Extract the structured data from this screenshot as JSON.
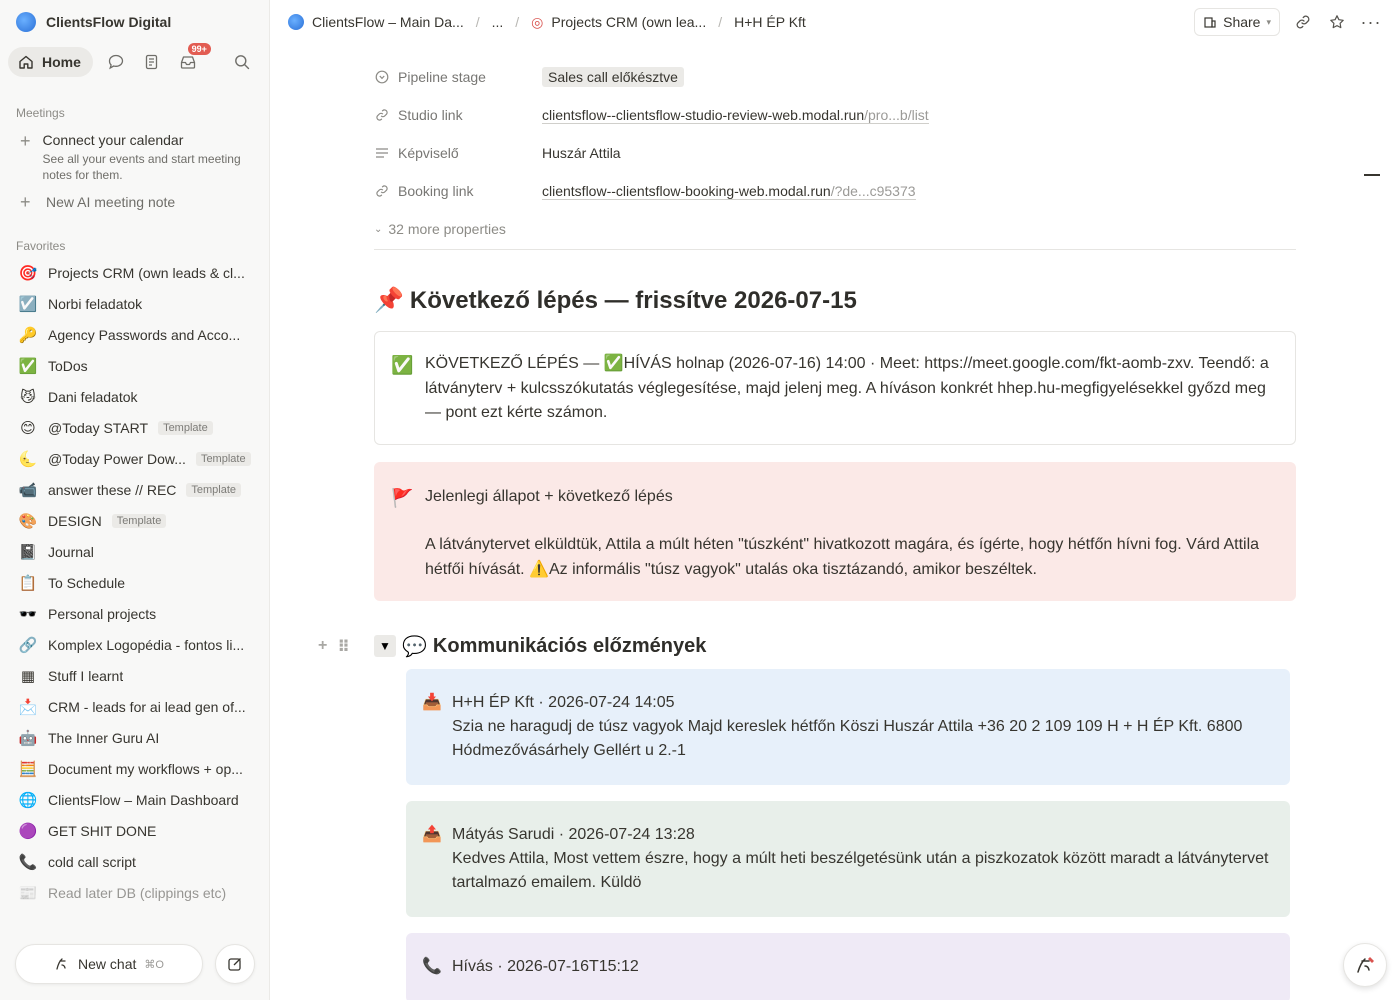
{
  "sidebar": {
    "workspace": "ClientsFlow Digital",
    "home": "Home",
    "inbox_badge": "99+",
    "meetings_label": "Meetings",
    "connect_title": "Connect your calendar",
    "connect_sub": "See all your events and start meeting notes for them.",
    "new_ai_note": "New AI meeting note",
    "favorites_label": "Favorites",
    "favorites": [
      {
        "icon": "🎯",
        "label": "Projects CRM (own leads & cl...",
        "template": ""
      },
      {
        "icon": "☑️",
        "label": "Norbi feladatok",
        "template": ""
      },
      {
        "icon": "🔑",
        "label": "Agency Passwords and Acco...",
        "template": ""
      },
      {
        "icon": "✅",
        "label": "ToDos",
        "template": ""
      },
      {
        "icon": "😼",
        "label": "Dani feladatok",
        "template": ""
      },
      {
        "icon": "😊",
        "label": "@Today START",
        "template": "Template"
      },
      {
        "icon": "🌜",
        "label": "@Today Power Dow...",
        "template": "Template"
      },
      {
        "icon": "📹",
        "label": "answer these // REC",
        "template": "Template"
      },
      {
        "icon": "🎨",
        "label": "DESIGN",
        "template": "Template"
      },
      {
        "icon": "📓",
        "label": "Journal",
        "template": ""
      },
      {
        "icon": "📋",
        "label": "To Schedule",
        "template": ""
      },
      {
        "icon": "🕶️",
        "label": "Personal projects",
        "template": ""
      },
      {
        "icon": "🔗",
        "label": "Komplex Logopédia - fontos li...",
        "template": ""
      },
      {
        "icon": "▦",
        "label": "Stuff I learnt",
        "template": ""
      },
      {
        "icon": "📩",
        "label": "CRM - leads for ai lead gen of...",
        "template": ""
      },
      {
        "icon": "🤖",
        "label": "The Inner Guru AI",
        "template": ""
      },
      {
        "icon": "🧮",
        "label": "Document my workflows + op...",
        "template": ""
      },
      {
        "icon": "🌐",
        "label": "ClientsFlow – Main Dashboard",
        "template": ""
      },
      {
        "icon": "🟣",
        "label": "GET SHIT DONE",
        "template": ""
      },
      {
        "icon": "📞",
        "label": "cold call script",
        "template": ""
      },
      {
        "icon": "📰",
        "label": "Read later DB (clippings etc)",
        "template": ""
      }
    ],
    "new_chat": "New chat",
    "new_chat_kbd": "⌘O"
  },
  "topbar": {
    "crumb1": "ClientsFlow – Main Da...",
    "crumb2": "...",
    "crumb3": "Projects CRM (own lea...",
    "crumb4": "H+H ÉP Kft",
    "share": "Share"
  },
  "properties": {
    "pipeline_label": "Pipeline stage",
    "pipeline_value": "Sales call előkésztve",
    "studio_label": "Studio link",
    "studio_main": "clientsflow--clientsflow-studio-review-web.modal.run",
    "studio_dim": "/pro...b/list",
    "rep_label": "Képviselő",
    "rep_value": "Huszár Attila",
    "booking_label": "Booking link",
    "booking_main": "clientsflow--clientsflow-booking-web.modal.run",
    "booking_dim": "/?de...c95373",
    "more": "32 more properties"
  },
  "next_step": {
    "heading_icon": "📌",
    "heading": "Következő lépés — frissítve 2026-07-15",
    "callout_icon": "✅",
    "callout_text": "KÖVETKEZŐ LÉPÉS — ✅HÍVÁS holnap (2026-07-16) 14:00 · Meet: https://meet.google.com/fkt-aomb-zxv. Teendő: a látványterv + kulcsszókutatás véglegesítése, majd jelenj meg. A híváson konkrét hhep.hu-megfigyelésekkel győzd meg — pont ezt kérte számon."
  },
  "status_callout": {
    "icon": "🚩",
    "title": "Jelenlegi állapot + következő lépés",
    "body": "A látványtervet elküldtük, Attila a múlt héten \"túszként\" hivatkozott magára, és ígérte, hogy hétfőn hívni fog. Várd Attila hétfői hívását. ⚠️Az informális \"túsz vagyok\" utalás oka tisztázandó, amikor beszéltek."
  },
  "history": {
    "icon": "💬",
    "heading": "Kommunikációs előzmények",
    "messages": [
      {
        "icon": "📥",
        "title": "H+H ÉP Kft · 2026-07-24 14:05",
        "body": "Szia ne haragudj de túsz vagyok Majd kereslek hétfőn Köszi Huszár Attila +36 20 2 109 109 H + H ÉP Kft. 6800 Hódmezővásárhely Gellért u 2.-1"
      },
      {
        "icon": "📤",
        "title": "Mátyás Sarudi · 2026-07-24 13:28",
        "body": "Kedves Attila, Most vettem észre, hogy a múlt heti beszélgetésünk után a piszkozatok között maradt a látványtervet tartalmazó emailem. Küldö"
      },
      {
        "icon": "📞",
        "title": "Hívás · 2026-07-16T15:12",
        "body": ""
      }
    ]
  },
  "colors": {
    "sidebar_bg": "#f8f8f7",
    "red_callout": "#fbe9e7",
    "blue_msg": "#e7f0fa",
    "green_msg": "#e8efea",
    "purple_msg": "#efeaf6",
    "badge": "#e25c52"
  }
}
